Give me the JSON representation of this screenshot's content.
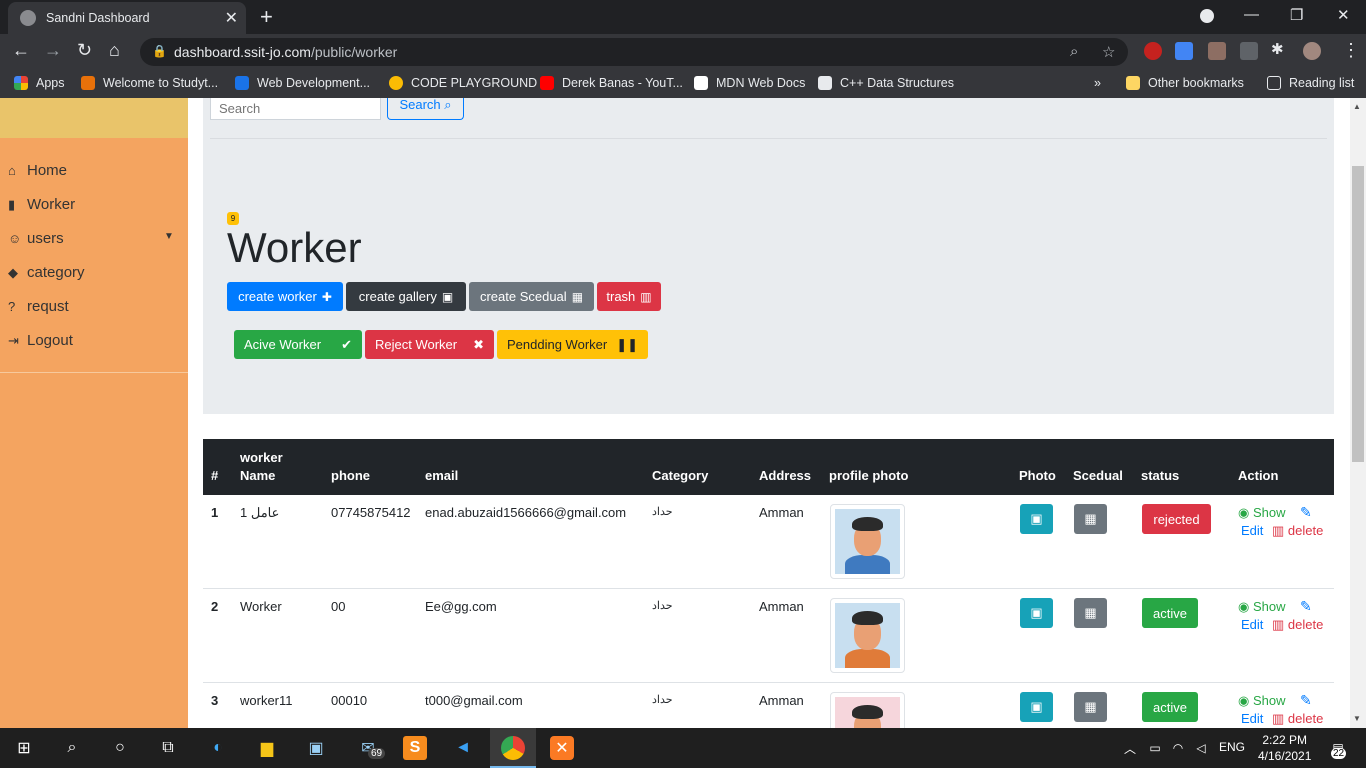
{
  "browser": {
    "tab_title": "Sandni Dashboard",
    "url_host": "dashboard.ssit-jo.com",
    "url_path": "/public/worker",
    "bookmarks": [
      {
        "label": "Apps",
        "color": "#4285f4"
      },
      {
        "label": "Welcome to Studyt...",
        "color": "#e8710a"
      },
      {
        "label": "Web Development...",
        "color": "#1a73e8"
      },
      {
        "label": "CODE PLAYGROUND",
        "color": "#fbbc04"
      },
      {
        "label": "Derek Banas - YouT...",
        "color": "#ff0000"
      },
      {
        "label": "MDN Web Docs",
        "color": "#ffffff"
      },
      {
        "label": "C++ Data Structures",
        "color": "#e8eaed"
      }
    ],
    "bookmarks_overflow": "»",
    "other_bookmarks": "Other bookmarks",
    "reading_list": "Reading list"
  },
  "sidebar": {
    "items": [
      {
        "label": "Home",
        "icon": "⌂"
      },
      {
        "label": "Worker",
        "icon": "▮"
      },
      {
        "label": "users",
        "icon": "☺"
      },
      {
        "label": "category",
        "icon": "◆"
      },
      {
        "label": "requst",
        "icon": "?"
      },
      {
        "label": "Logout",
        "icon": "⇥"
      }
    ]
  },
  "header": {
    "search_placeholder": "Search",
    "search_button": "Search",
    "count_badge": "9",
    "title": "Worker"
  },
  "actions": {
    "create_worker": "create worker",
    "create_gallery": "create gallery",
    "create_scedual": "create Scedual",
    "trash": "trash",
    "active_worker": "Acive Worker",
    "reject_worker": "Reject Worker",
    "pending_worker": "Pendding Worker"
  },
  "table": {
    "headers": {
      "num": "#",
      "name_line1": "worker",
      "name_line2": "Name",
      "phone": "phone",
      "email": "email",
      "category": "Category",
      "address": "Address",
      "profile_photo": "profile photo",
      "photo": "Photo",
      "scedual": "Scedual",
      "status": "status",
      "action": "Action"
    },
    "rows": [
      {
        "num": "1",
        "name": "عامل 1",
        "phone": "07745875412",
        "email": "enad.abuzaid1566666@gmail.com",
        "category": "حداد",
        "address": "Amman",
        "status": "rejected"
      },
      {
        "num": "2",
        "name": "Worker",
        "phone": "00",
        "email": "Ee@gg.com",
        "category": "حداد",
        "address": "Amman",
        "status": "active"
      },
      {
        "num": "3",
        "name": "worker11",
        "phone": "00010",
        "email": "t000@gmail.com",
        "category": "حداد",
        "address": "Amman",
        "status": "active"
      }
    ],
    "action_labels": {
      "show": "Show",
      "edit": "Edit",
      "delete": "delete"
    }
  },
  "colors": {
    "sidebar": "#f4a460",
    "primary": "#007bff",
    "dark": "#343a40",
    "secondary": "#6c757d",
    "danger": "#dc3545",
    "success": "#28a745",
    "warning": "#ffc107",
    "info": "#17a2b8"
  },
  "taskbar": {
    "lang": "ENG",
    "time": "2:22 PM",
    "date": "4/16/2021",
    "notifications": "22",
    "mail_badge": "69"
  }
}
